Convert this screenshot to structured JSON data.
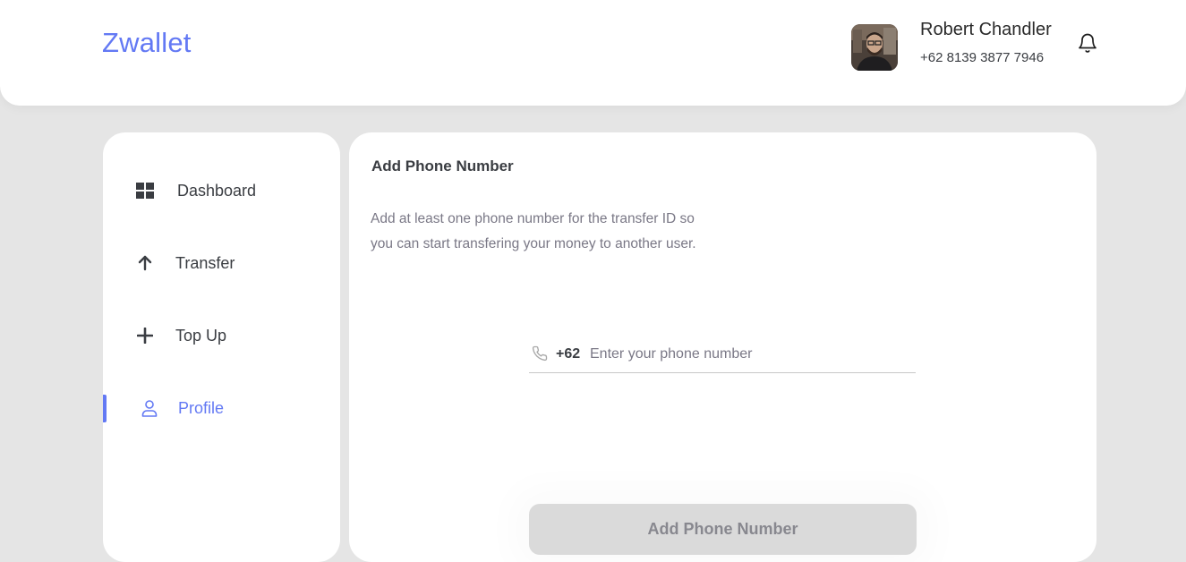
{
  "header": {
    "brand": "Zwallet",
    "user": {
      "name": "Robert Chandler",
      "phone": "+62 8139 3877 7946",
      "avatar": "user-avatar-photo"
    },
    "notification_icon": "bell-icon"
  },
  "sidebar": {
    "items": [
      {
        "label": "Dashboard",
        "icon": "grid-icon",
        "active": false
      },
      {
        "label": "Transfer",
        "icon": "arrow-up-icon",
        "active": false
      },
      {
        "label": "Top Up",
        "icon": "plus-icon",
        "active": false
      },
      {
        "label": "Profile",
        "icon": "user-icon",
        "active": true
      }
    ]
  },
  "main": {
    "title": "Add Phone Number",
    "description_line1": "Add at least one phone number for the transfer ID so",
    "description_line2": "you can start transfering your money to another user.",
    "phone_field": {
      "icon": "phone-icon",
      "prefix": "+62",
      "value": "",
      "placeholder": "Enter your phone number"
    },
    "submit_label": "Add Phone Number"
  },
  "colors": {
    "accent": "#6379f4",
    "background": "#e5e5e5",
    "text_dark": "#3a3d42",
    "text_muted": "#7a7886",
    "button_disabled": "#dadada"
  }
}
